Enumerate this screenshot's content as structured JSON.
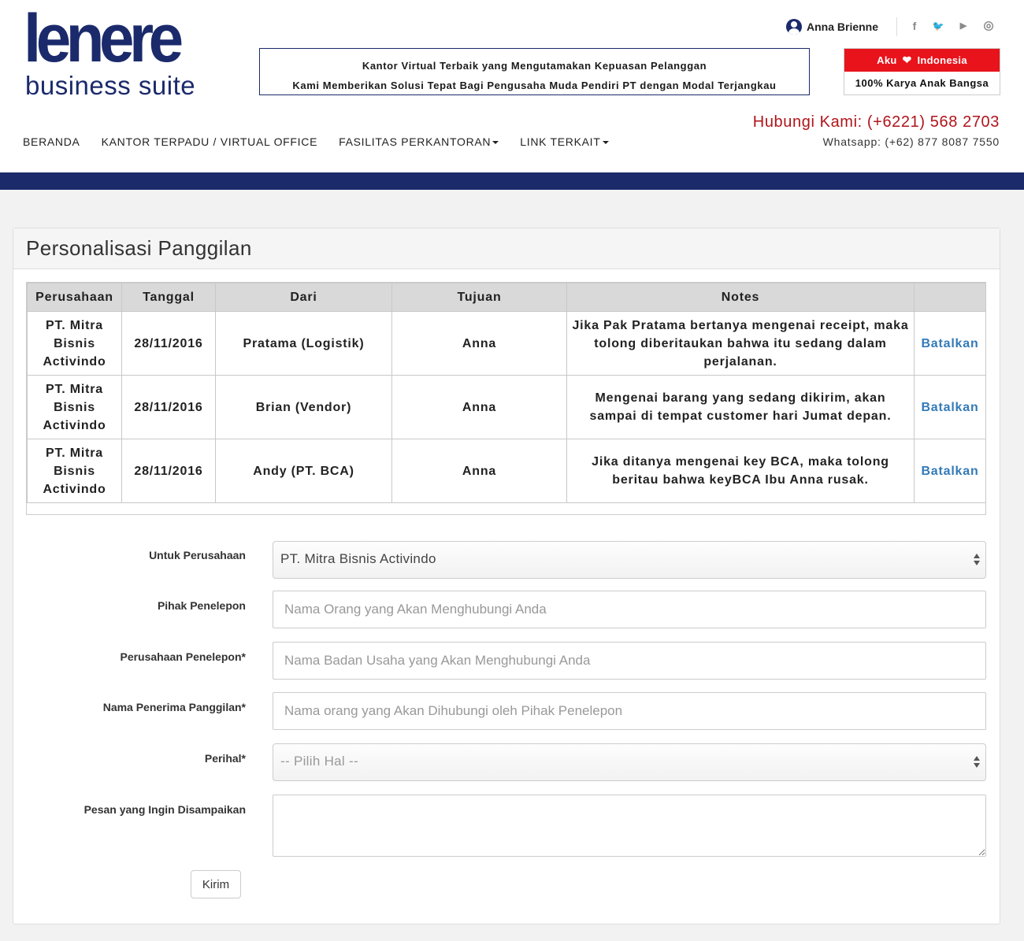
{
  "brand": {
    "logo_main": "lenere",
    "logo_sub": "business suite"
  },
  "tagline": {
    "line1": "Kantor Virtual Terbaik yang Mengutamakan Kepuasan Pelanggan",
    "line2": "Kami Memberikan Solusi Tepat Bagi Pengusaha Muda Pendiri PT dengan Modal Terjangkau"
  },
  "user": {
    "name": "Anna Brienne"
  },
  "social": [
    {
      "name": "facebook-icon",
      "glyph": "f"
    },
    {
      "name": "twitter-icon",
      "glyph": "🐦"
    },
    {
      "name": "youtube-icon",
      "glyph": "▶"
    },
    {
      "name": "instagram-icon",
      "glyph": "◎"
    }
  ],
  "badge": {
    "top_left": "Aku",
    "top_right": "Indonesia",
    "bottom": "100% Karya Anak Bangsa"
  },
  "nav": {
    "items": [
      {
        "label": "BERANDA",
        "dropdown": false
      },
      {
        "label": "KANTOR TERPADU / VIRTUAL OFFICE",
        "dropdown": false
      },
      {
        "label": "FASILITAS PERKANTORAN",
        "dropdown": true
      },
      {
        "label": "LINK TERKAIT",
        "dropdown": true
      }
    ]
  },
  "contact": {
    "phone": "Hubungi Kami: (+6221) 568 2703",
    "whatsapp": "Whatsapp: (+62) 877 8087 7550"
  },
  "panel": {
    "title": "Personalisasi Panggilan"
  },
  "table": {
    "headers": [
      "Perusahaan",
      "Tanggal",
      "Dari",
      "Tujuan",
      "Notes",
      ""
    ],
    "rows": [
      {
        "perusahaan": "PT. Mitra Bisnis Activindo",
        "tanggal": "28/11/2016",
        "dari": "Pratama (Logistik)",
        "tujuan": "Anna",
        "notes": "Jika Pak Pratama bertanya mengenai receipt, maka tolong diberitaukan bahwa itu sedang dalam perjalanan.",
        "action": "Batalkan"
      },
      {
        "perusahaan": "PT. Mitra Bisnis Activindo",
        "tanggal": "28/11/2016",
        "dari": "Brian (Vendor)",
        "tujuan": "Anna",
        "notes": "Mengenai barang yang sedang dikirim, akan sampai di tempat customer hari Jumat depan.",
        "action": "Batalkan"
      },
      {
        "perusahaan": "PT. Mitra Bisnis Activindo",
        "tanggal": "28/11/2016",
        "dari": "Andy (PT. BCA)",
        "tujuan": "Anna",
        "notes": "Jika ditanya mengenai key BCA, maka tolong beritau bahwa keyBCA Ibu Anna rusak.",
        "action": "Batalkan"
      }
    ]
  },
  "form": {
    "company_label": "Untuk Perusahaan",
    "company_value": "PT. Mitra Bisnis Activindo",
    "caller_label": "Pihak Penelepon",
    "caller_placeholder": "Nama Orang yang Akan Menghubungi Anda",
    "caller_company_label": "Perusahaan Penelepon*",
    "caller_company_placeholder": "Nama Badan Usaha yang Akan Menghubungi Anda",
    "recipient_label": "Nama Penerima Panggilan*",
    "recipient_placeholder": "Nama orang yang Akan Dihubungi oleh Pihak Penelepon",
    "subject_label": "Perihal*",
    "subject_value": "-- Pilih Hal --",
    "message_label": "Pesan yang Ingin Disampaikan",
    "submit_label": "Kirim"
  },
  "colors": {
    "brand_navy": "#1b2a6b",
    "accent_red": "#e8131b",
    "phone_red": "#b0141b",
    "link_blue": "#337ab7"
  }
}
